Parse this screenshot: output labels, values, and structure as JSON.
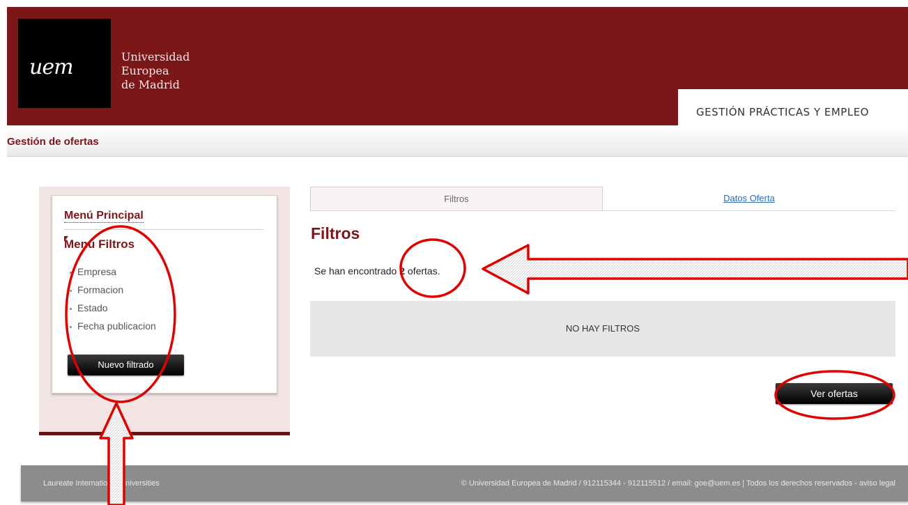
{
  "header": {
    "logo_mark": "uem",
    "logo_lines": [
      "Universidad",
      "Europea",
      "de Madrid"
    ],
    "banner": "GESTIÓN PRÁCTICAS Y EMPLEO"
  },
  "subbar": {
    "title": "Gestión de ofertas"
  },
  "sidebar": {
    "menu_principal": "Menú Principal",
    "menu_filtros": "Menú Filtros",
    "filters": [
      "Empresa",
      "Formacion",
      "Estado",
      "Fecha publicacion"
    ],
    "new_filter_button": "Nuevo filtrado"
  },
  "tabs": [
    {
      "label": "Filtros",
      "active": true
    },
    {
      "label": "Datos Oferta",
      "active": false
    }
  ],
  "main": {
    "title": "Filtros",
    "result_prefix": "Se han encontrado ",
    "result_count": "2",
    "result_suffix": " ofertas.",
    "no_filters": "NO HAY FILTROS",
    "view_offers_button": "Ver ofertas"
  },
  "footer": {
    "left": "Laureate International Universities",
    "right": "© Universidad Europea de Madrid / 912115344 - 912115512 / email: goe@uem.es | Todos los derechos reservados - aviso legal"
  },
  "colors": {
    "brand": "#7b1619",
    "annotation": "#e00000",
    "link": "#2a6bb5"
  }
}
